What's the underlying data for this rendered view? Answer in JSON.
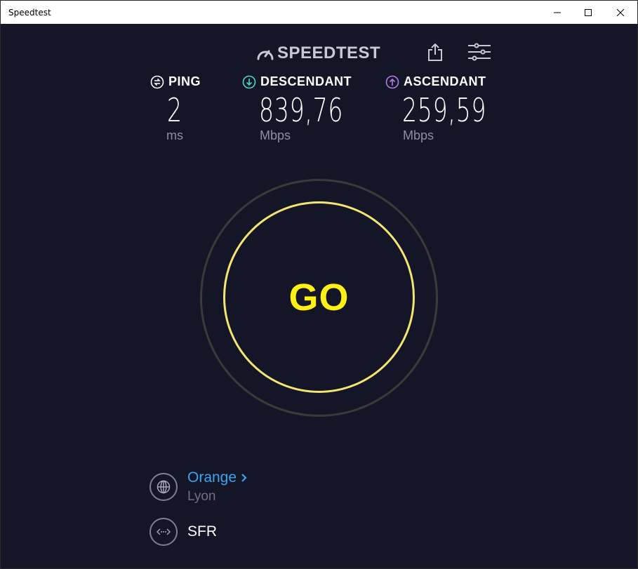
{
  "window": {
    "title": "Speedtest"
  },
  "header": {
    "logo_text": "SPEEDTEST",
    "share_icon": "share-icon",
    "settings_icon": "sliders-icon"
  },
  "metrics": {
    "ping": {
      "label": "PING",
      "value": "2",
      "unit": "ms",
      "icon": "ping-icon"
    },
    "download": {
      "label": "DESCENDANT",
      "value": "839,76",
      "unit": "Mbps",
      "icon": "download-arrow-icon",
      "color": "#4fd6c6"
    },
    "upload": {
      "label": "ASCENDANT",
      "value": "259,59",
      "unit": "Mbps",
      "icon": "upload-arrow-icon",
      "color": "#b37de8"
    }
  },
  "go_button": {
    "label": "GO",
    "ring_color": "#f4e573",
    "text_color": "#fef014"
  },
  "server": {
    "name": "Orange",
    "chevron": ">",
    "location": "Lyon",
    "icon": "globe-icon"
  },
  "provider": {
    "name": "SFR",
    "icon": "connection-icon"
  }
}
